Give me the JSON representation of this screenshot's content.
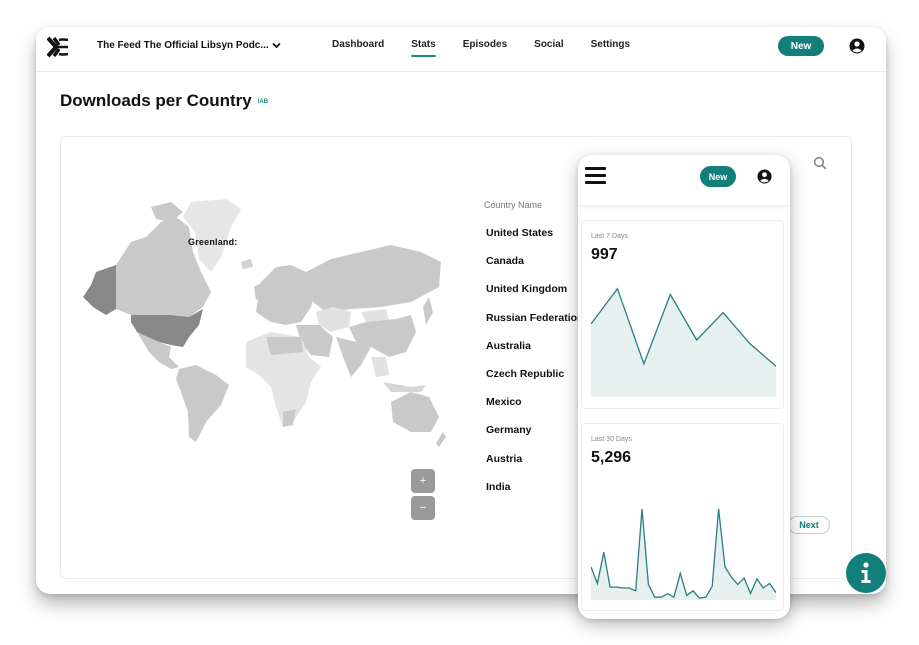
{
  "header": {
    "podcast_name": "The Feed The Official Libsyn Podc...",
    "nav": [
      {
        "label": "Dashboard",
        "active": false
      },
      {
        "label": "Stats",
        "active": true
      },
      {
        "label": "Episodes",
        "active": false
      },
      {
        "label": "Social",
        "active": false
      },
      {
        "label": "Settings",
        "active": false
      }
    ],
    "new_label": "New",
    "icons": {
      "logo": "libsyn-logo",
      "dropdown": "chevron-down-icon",
      "user": "user-circle-icon"
    }
  },
  "page": {
    "title": "Downloads per Country",
    "badge": "IAB"
  },
  "map": {
    "tooltip": "Greenland:",
    "zoom_in": "+",
    "zoom_out": "−",
    "highlighted_countries": [
      "United States",
      "Alaska (US)"
    ],
    "colors": {
      "highlight": "#8a8a8a",
      "mid": "#c9c9c9",
      "light": "#e4e4e4"
    }
  },
  "table": {
    "column_header": "Country Name",
    "countries": [
      "United States",
      "Canada",
      "United Kingdom",
      "Russian Federation",
      "Australia",
      "Czech Republic",
      "Mexico",
      "Germany",
      "Austria",
      "India"
    ],
    "next_label": "Next"
  },
  "mobile": {
    "new_label": "New",
    "cards": [
      {
        "label": "Last 7 Days",
        "value": "997",
        "series": [
          0.64,
          0.95,
          0.29,
          0.9,
          0.5,
          0.74,
          0.47,
          0.27
        ]
      },
      {
        "label": "Last 30 Days",
        "value": "5,296",
        "series": [
          0.36,
          0.18,
          0.52,
          0.14,
          0.14,
          0.13,
          0.13,
          0.1,
          0.99,
          0.17,
          0.03,
          0.03,
          0.07,
          0.03,
          0.29,
          0.05,
          0.1,
          0.02,
          0.03,
          0.15,
          0.99,
          0.36,
          0.25,
          0.17,
          0.24,
          0.07,
          0.23,
          0.13,
          0.18,
          0.08
        ]
      }
    ]
  },
  "colors": {
    "accent": "#137f7b",
    "chart_line": "#2a7f80",
    "chart_fill": "#e6f0ef"
  }
}
